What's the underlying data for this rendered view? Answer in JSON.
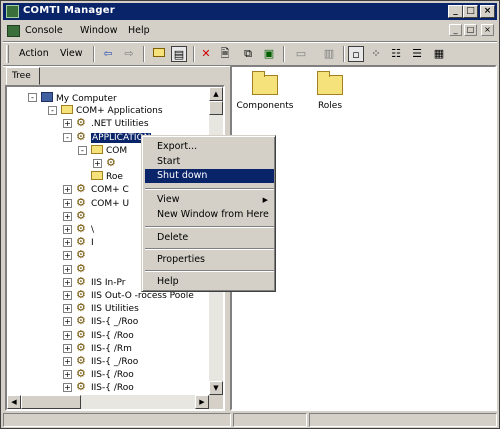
{
  "window": {
    "title": "COMTI Manager"
  },
  "titlebar_buttons": {
    "minimize": "_",
    "maximize": "□",
    "close": "×"
  },
  "menubar": {
    "items": [
      "Console",
      "Window",
      "Help"
    ],
    "mdi_buttons": [
      "_",
      "□",
      "×"
    ]
  },
  "toolbar": {
    "action_label": "Action",
    "view_label": "View"
  },
  "left_pane": {
    "tab_label": "Tree"
  },
  "tree": [
    {
      "label": "My Computer",
      "icon": "computer-icon",
      "expander": "-"
    },
    {
      "label": "COM+ Applications",
      "icon": "folder-icon",
      "expander": "-"
    },
    {
      "label": ".NET Utilities",
      "icon": "gear-icon",
      "expander": "+"
    },
    {
      "label": "APPLICATION",
      "icon": "gear-icon",
      "expander": "-",
      "selected": true
    },
    {
      "label": "COM",
      "icon": "folder-icon",
      "expander": "-"
    },
    {
      "label": "",
      "icon": "gear-icon",
      "expander": "+"
    },
    {
      "label": "Roe",
      "icon": "folder-icon",
      "expander": ""
    },
    {
      "label": "COM+ C",
      "icon": "gear-icon",
      "expander": "+"
    },
    {
      "label": "COM+ U",
      "icon": "gear-icon",
      "expander": "+"
    },
    {
      "label": "",
      "icon": "gear-icon",
      "expander": "+"
    },
    {
      "label": "\\",
      "icon": "gear-icon",
      "expander": "+"
    },
    {
      "label": "I",
      "icon": "gear-icon",
      "expander": "+"
    },
    {
      "label": "",
      "icon": "gear-icon",
      "expander": "+"
    },
    {
      "label": "",
      "icon": "gear-icon",
      "expander": "+"
    },
    {
      "label": "IIS In-Pr",
      "icon": "gear-icon",
      "expander": "+"
    },
    {
      "label": "IIS Out-O -rocess Poole",
      "icon": "gear-icon",
      "expander": "+"
    },
    {
      "label": "IIS Utilities",
      "icon": "gear-icon",
      "expander": "+"
    },
    {
      "label": "IIS-{ _/Roo",
      "icon": "gear-icon",
      "expander": "+"
    },
    {
      "label": "IIS-{ /Roo",
      "icon": "gear-icon",
      "expander": "+"
    },
    {
      "label": "IIS-{ /Rm",
      "icon": "gear-icon",
      "expander": "+"
    },
    {
      "label": "IIS-{ _/Roo",
      "icon": "gear-icon",
      "expander": "+"
    },
    {
      "label": "IIS-{ /Roo",
      "icon": "gear-icon",
      "expander": "+"
    },
    {
      "label": "IIS-{ /Roo",
      "icon": "gear-icon",
      "expander": "+"
    }
  ],
  "right_pane": {
    "items": [
      "Components",
      "Roles"
    ]
  },
  "context_menu": {
    "items": [
      "Export...",
      "Start",
      "Shut down",
      "View",
      "New Window from Here",
      "Delete",
      "Properties",
      "Help"
    ],
    "highlighted": "Shut down",
    "submenu_arrow": "▶"
  }
}
